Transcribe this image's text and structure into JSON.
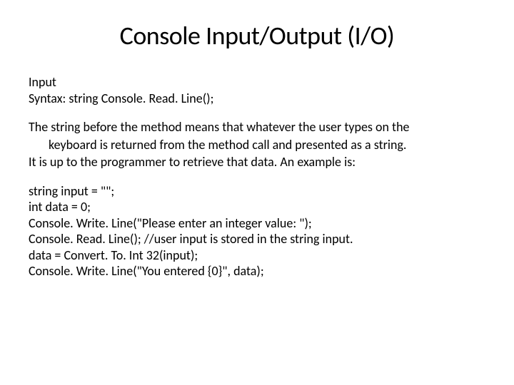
{
  "title": "Console Input/Output (I/O)",
  "sectionLabel": "Input",
  "syntaxLine": "Syntax: string Console. Read. Line();",
  "desc1": "The string before the method means that whatever the user types on the",
  "desc2": "keyboard is returned from the method call and presented as a string.",
  "desc3": "It is up to the programmer to retrieve that data. An example is:",
  "code1": "string input = \"\";",
  "code2": "int data = 0;",
  "code3": "Console. Write. Line(\"Please enter an integer value: \");",
  "code4": "Console. Read. Line(); //user input is stored in the string input.",
  "code5": "data = Convert. To. Int 32(input);",
  "code6": "Console. Write. Line(\"You entered {0}\", data);"
}
